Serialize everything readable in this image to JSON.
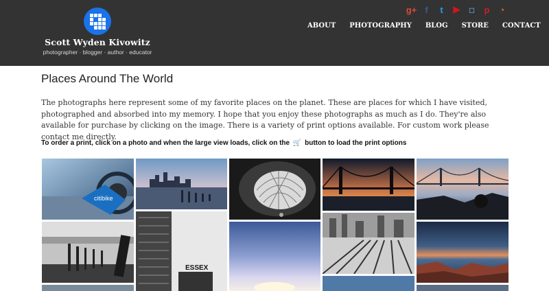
{
  "header": {
    "site_name": "Scott Wyden Kivowitz",
    "tagline": "photographer · blogger · author · educator",
    "social_icons": [
      {
        "name": "google-plus-icon",
        "glyph": "g+",
        "color": "#dd4b39"
      },
      {
        "name": "facebook-icon",
        "glyph": "f",
        "color": "#3b5998"
      },
      {
        "name": "twitter-icon",
        "glyph": "t",
        "color": "#1da1f2"
      },
      {
        "name": "youtube-icon",
        "glyph": "▶",
        "color": "#cc181e"
      },
      {
        "name": "instagram-icon",
        "glyph": "◘",
        "color": "#517fa4"
      },
      {
        "name": "pinterest-icon",
        "glyph": "p",
        "color": "#cb2027"
      },
      {
        "name": "rss-icon",
        "glyph": "◔",
        "color": "#f26522"
      }
    ],
    "nav": [
      "ABOUT",
      "PHOTOGRAPHY",
      "BLOG",
      "STORE",
      "CONTACT"
    ]
  },
  "main": {
    "title": "Places Around The World",
    "intro": "The photographs here represent some of my favorite places on the planet. These are places for which I have visited, photographed and absorbed into my memory. I hope that you enjoy these photographs as much as I do. They're also available for purchase by clicking on the image. There is a variety of print options available. For custom work please contact me directly.",
    "order_before": "To order a print, click on a photo and when the large view loads, click on the",
    "order_after": "button to load the print options",
    "photo_texts": {
      "citibike": "citibike",
      "essex": "ESSEX"
    }
  },
  "colors": {
    "header_bg": "#333333",
    "logo_blue": "#1a73e8"
  }
}
